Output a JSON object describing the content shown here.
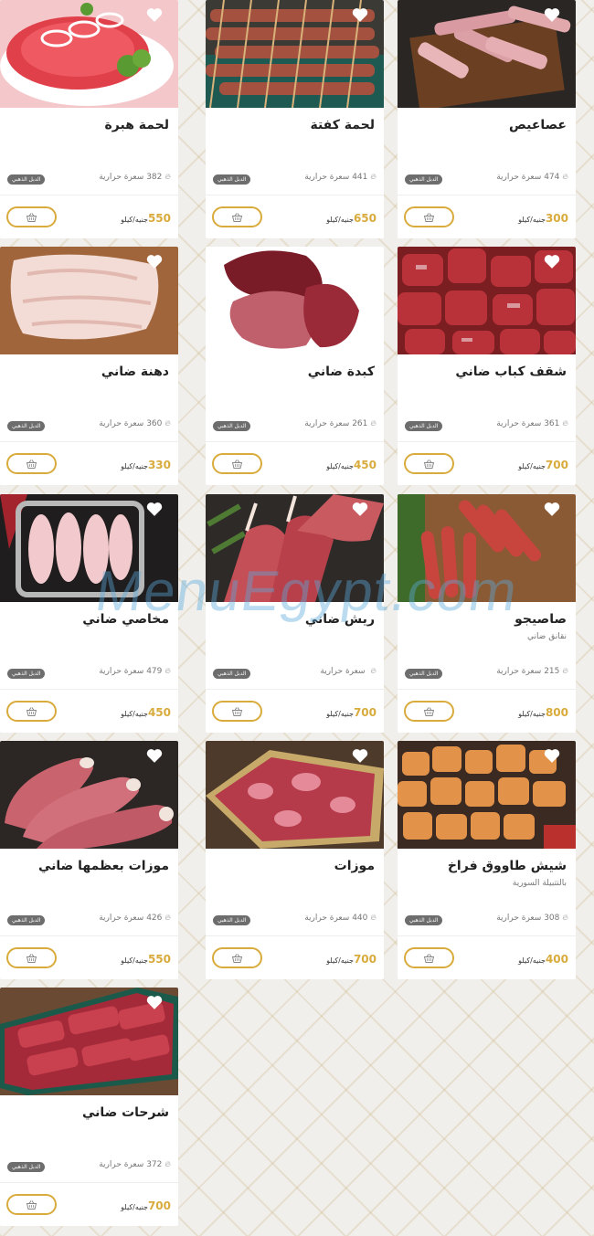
{
  "currency_unit": "جنيه/كيلو",
  "calories_suffix": "سعرة حرارية",
  "watermark": "MenuEgypt.com",
  "colors": {
    "accent": "#d8ab3c",
    "badge": "#6d6d6d",
    "background": "#f1efec"
  },
  "products": [
    {
      "name": "عصاعيص",
      "subtitle": "",
      "badge": "الدبل الذهبي",
      "calories": "474",
      "price": "300",
      "image": "lamb-ribs-image"
    },
    {
      "name": "لحمة كفتة",
      "subtitle": "",
      "badge": "الدبل الذهبي",
      "calories": "441",
      "price": "650",
      "image": "kofta-skewers-image"
    },
    {
      "name": "لحمة هبرة",
      "subtitle": "",
      "badge": "الدبل الذهبي",
      "calories": "382",
      "price": "550",
      "image": "minced-meat-image"
    },
    {
      "name": "شقف كباب ضاني",
      "subtitle": "",
      "badge": "الدبل الذهبي",
      "calories": "361",
      "price": "700",
      "image": "lamb-cubes-image"
    },
    {
      "name": "كبدة ضاني",
      "subtitle": "",
      "badge": "الدبل الذهبي",
      "calories": "261",
      "price": "450",
      "image": "lamb-liver-image"
    },
    {
      "name": "دهنة ضاني",
      "subtitle": "",
      "badge": "الدبل الذهبي",
      "calories": "360",
      "price": "330",
      "image": "lamb-fat-image"
    },
    {
      "name": "صاصيجو",
      "subtitle": "نقانق ضاني",
      "badge": "الدبل الذهبي",
      "calories": "215",
      "price": "800",
      "image": "sausage-image"
    },
    {
      "name": "ريش ضاني",
      "subtitle": "",
      "badge": "الدبل الذهبي",
      "calories": "",
      "price": "700",
      "image": "lamb-chops-image"
    },
    {
      "name": "مخاصي ضاني",
      "subtitle": "",
      "badge": "الدبل الذهبي",
      "calories": "479",
      "price": "450",
      "image": "lamb-testicles-image"
    },
    {
      "name": "شيش طاووق فراخ",
      "subtitle": "بالتتبيلة السورية",
      "badge": "الدبل الذهبي",
      "calories": "308",
      "price": "400",
      "image": "chicken-tawook-image"
    },
    {
      "name": "موزات",
      "subtitle": "",
      "badge": "الدبل الذهبي",
      "calories": "440",
      "price": "700",
      "image": "shanks-image"
    },
    {
      "name": "موزات بعظمها ضاني",
      "subtitle": "",
      "badge": "الدبل الذهبي",
      "calories": "426",
      "price": "550",
      "image": "bone-shanks-image"
    },
    {
      "name": "شرحات ضاني",
      "subtitle": "",
      "badge": "الدبل الذهبي",
      "calories": "372",
      "price": "700",
      "image": "lamb-slices-image"
    }
  ]
}
